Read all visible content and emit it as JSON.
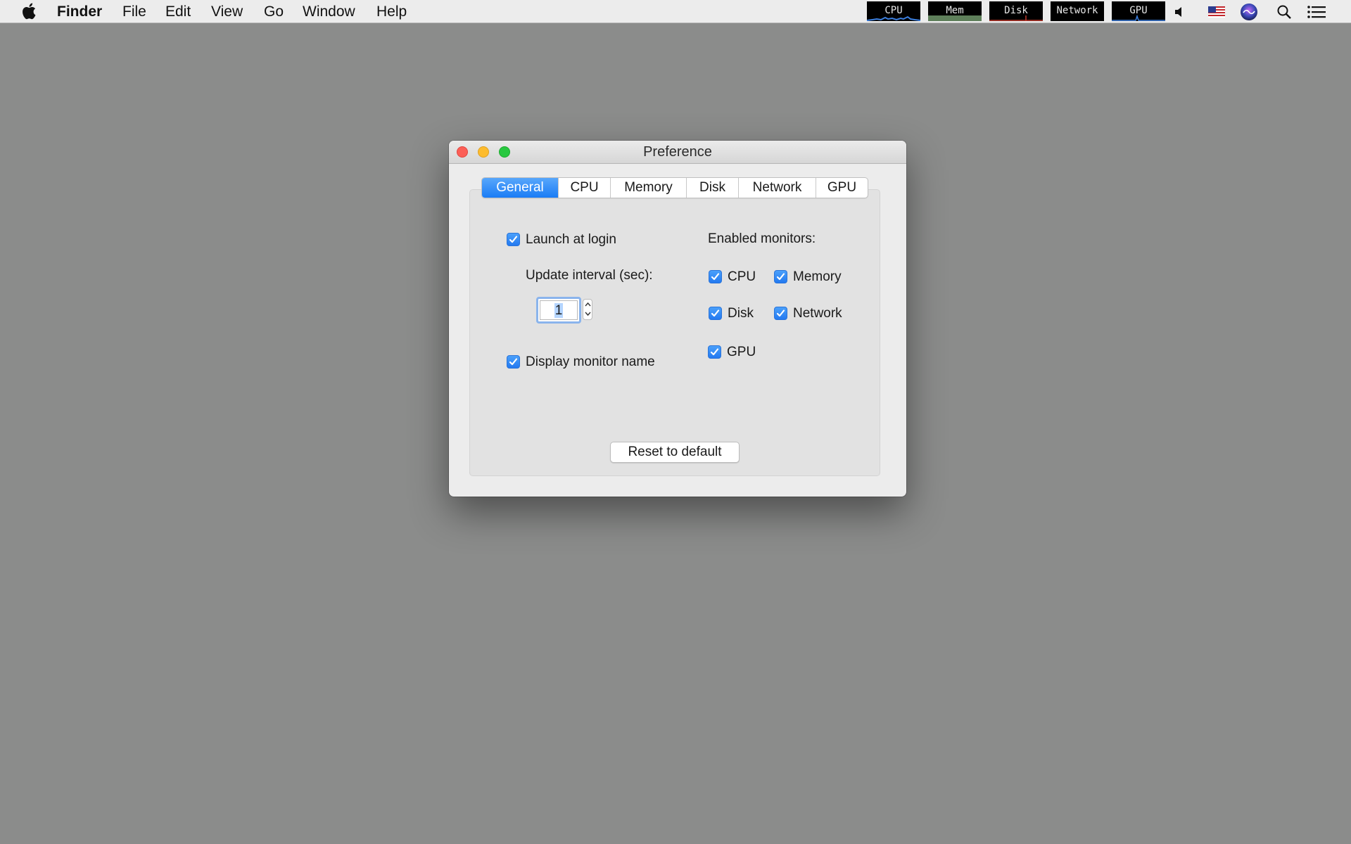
{
  "menubar": {
    "app_name": "Finder",
    "items": [
      "File",
      "Edit",
      "View",
      "Go",
      "Window",
      "Help"
    ],
    "monitors": [
      "CPU",
      "Mem",
      "Disk",
      "Network",
      "GPU"
    ],
    "icons": [
      "apple-icon",
      "volume-icon",
      "us-flag-icon",
      "siri-icon",
      "spotlight-search-icon",
      "notification-center-icon"
    ]
  },
  "window": {
    "title": "Preference",
    "tabs": [
      {
        "label": "General",
        "active": true
      },
      {
        "label": "CPU",
        "active": false
      },
      {
        "label": "Memory",
        "active": false
      },
      {
        "label": "Disk",
        "active": false
      },
      {
        "label": "Network",
        "active": false
      },
      {
        "label": "GPU",
        "active": false
      }
    ],
    "general": {
      "launch_at_login": {
        "label": "Launch at login",
        "checked": true
      },
      "update_interval_label": "Update interval (sec):",
      "update_interval_value": "1",
      "display_monitor_name": {
        "label": "Display monitor name",
        "checked": true
      },
      "enabled_monitors_label": "Enabled monitors:",
      "monitors": [
        {
          "label": "CPU",
          "checked": true
        },
        {
          "label": "Memory",
          "checked": true
        },
        {
          "label": "Disk",
          "checked": true
        },
        {
          "label": "Network",
          "checked": true
        },
        {
          "label": "GPU",
          "checked": true
        }
      ],
      "reset_button": "Reset to default"
    }
  },
  "colors": {
    "desktop": "#8b8c8b",
    "accent": "#1a7cf5",
    "close": "#fc5f57",
    "minimize": "#fdbc2e",
    "maximize": "#28c840"
  }
}
